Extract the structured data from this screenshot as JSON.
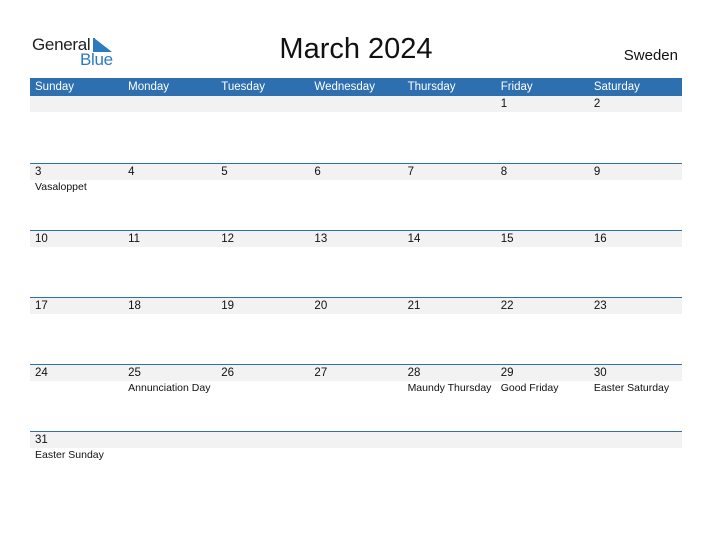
{
  "logo": {
    "word1": "General",
    "word2": "Blue"
  },
  "title": "March 2024",
  "country": "Sweden",
  "colors": {
    "accent": "#2e6fb0",
    "band": "#f2f2f2"
  },
  "weekdays": [
    "Sunday",
    "Monday",
    "Tuesday",
    "Wednesday",
    "Thursday",
    "Friday",
    "Saturday"
  ],
  "weeks": [
    [
      {
        "day": "",
        "holiday": ""
      },
      {
        "day": "",
        "holiday": ""
      },
      {
        "day": "",
        "holiday": ""
      },
      {
        "day": "",
        "holiday": ""
      },
      {
        "day": "",
        "holiday": ""
      },
      {
        "day": "1",
        "holiday": ""
      },
      {
        "day": "2",
        "holiday": ""
      }
    ],
    [
      {
        "day": "3",
        "holiday": "Vasaloppet"
      },
      {
        "day": "4",
        "holiday": ""
      },
      {
        "day": "5",
        "holiday": ""
      },
      {
        "day": "6",
        "holiday": ""
      },
      {
        "day": "7",
        "holiday": ""
      },
      {
        "day": "8",
        "holiday": ""
      },
      {
        "day": "9",
        "holiday": ""
      }
    ],
    [
      {
        "day": "10",
        "holiday": ""
      },
      {
        "day": "11",
        "holiday": ""
      },
      {
        "day": "12",
        "holiday": ""
      },
      {
        "day": "13",
        "holiday": ""
      },
      {
        "day": "14",
        "holiday": ""
      },
      {
        "day": "15",
        "holiday": ""
      },
      {
        "day": "16",
        "holiday": ""
      }
    ],
    [
      {
        "day": "17",
        "holiday": ""
      },
      {
        "day": "18",
        "holiday": ""
      },
      {
        "day": "19",
        "holiday": ""
      },
      {
        "day": "20",
        "holiday": ""
      },
      {
        "day": "21",
        "holiday": ""
      },
      {
        "day": "22",
        "holiday": ""
      },
      {
        "day": "23",
        "holiday": ""
      }
    ],
    [
      {
        "day": "24",
        "holiday": ""
      },
      {
        "day": "25",
        "holiday": "Annunciation Day"
      },
      {
        "day": "26",
        "holiday": ""
      },
      {
        "day": "27",
        "holiday": ""
      },
      {
        "day": "28",
        "holiday": "Maundy Thursday"
      },
      {
        "day": "29",
        "holiday": "Good Friday"
      },
      {
        "day": "30",
        "holiday": "Easter Saturday"
      }
    ],
    [
      {
        "day": "31",
        "holiday": "Easter Sunday"
      },
      {
        "day": "",
        "holiday": ""
      },
      {
        "day": "",
        "holiday": ""
      },
      {
        "day": "",
        "holiday": ""
      },
      {
        "day": "",
        "holiday": ""
      },
      {
        "day": "",
        "holiday": ""
      },
      {
        "day": "",
        "holiday": ""
      }
    ]
  ]
}
